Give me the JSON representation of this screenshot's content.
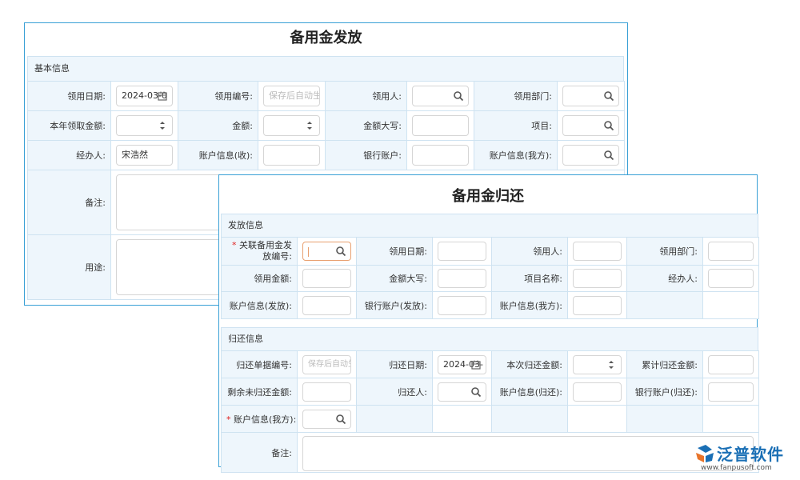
{
  "back": {
    "title": "备用金发放",
    "section": "基本信息",
    "labels": {
      "date": "领用日期:",
      "code": "领用编号:",
      "person": "领用人:",
      "dept": "领用部门:",
      "year_amount": "本年领取金额:",
      "amount": "金额:",
      "amount_upper": "金额大写:",
      "project": "项目:",
      "handler": "经办人:",
      "account_recv": "账户信息(收):",
      "bank_account": "银行账户:",
      "account_ours": "账户信息(我方):",
      "remark": "备注:",
      "purpose": "用途:"
    },
    "values": {
      "date": "2024-03-0",
      "handler": "宋浩然"
    },
    "placeholders": {
      "code": "保存后自动生"
    }
  },
  "front": {
    "title": "备用金归还",
    "section1": "发放信息",
    "section2": "归还信息",
    "required_mark": "*",
    "labels": {
      "related_no": "关联备用金发放编号:",
      "date": "领用日期:",
      "person": "领用人:",
      "dept": "领用部门:",
      "amount": "领用金额:",
      "amount_upper": "金额大写:",
      "project_name": "项目名称:",
      "handler": "经办人:",
      "account_issue": "账户信息(发放):",
      "bank_issue": "银行账户(发放):",
      "account_ours": "账户信息(我方):",
      "return_no": "归还单据编号:",
      "return_date": "归还日期:",
      "this_return": "本次归还金额:",
      "total_return": "累计归还金额:",
      "remaining": "剩余未归还金额:",
      "returner": "归还人:",
      "account_return": "账户信息(归还):",
      "bank_return": "银行账户(归还):",
      "account_ours2": "账户信息(我方):",
      "remark": "备注:"
    },
    "values": {
      "return_date": "2024-03-"
    },
    "placeholders": {
      "return_no": "保存后自动生"
    }
  },
  "logo": {
    "name": "泛普软件",
    "url": "www.fanpusoft.com",
    "color": "#1a6fb5"
  }
}
